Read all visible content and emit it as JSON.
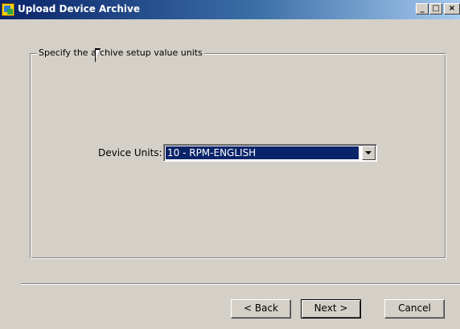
{
  "window": {
    "title": "Upload Device Archive",
    "app_icon": "archive-app-icon",
    "controls": {
      "minimize": "_",
      "maximize": "□",
      "close": "×"
    }
  },
  "group": {
    "legend": "Specify the archive setup value units"
  },
  "device_units": {
    "label": "Device Units:",
    "selected": "10 - RPM-ENGLISH"
  },
  "buttons": {
    "back": "< Back",
    "next": "Next >",
    "cancel": "Cancel"
  },
  "colors": {
    "titlebar_start": "#0a246a",
    "titlebar_end": "#a6caf0",
    "dialog_bg": "#d4d0c8",
    "selection_bg": "#0a246a"
  }
}
